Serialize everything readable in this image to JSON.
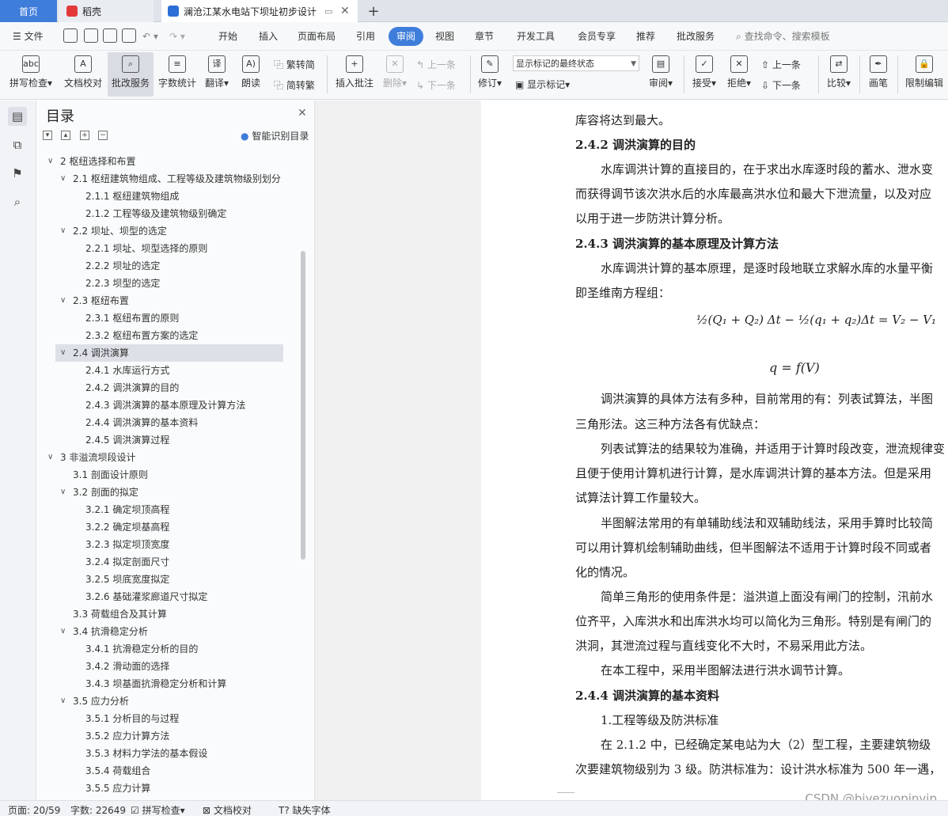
{
  "tabs": {
    "home": "首页",
    "daoke": "稻壳",
    "doc": "澜沧江某水电站下坝址初步设计"
  },
  "menu": {
    "file": "文件",
    "items": [
      "开始",
      "插入",
      "页面布局",
      "引用",
      "审阅",
      "视图",
      "章节",
      "开发工具",
      "会员专享",
      "推荐",
      "批改服务"
    ],
    "active": "审阅",
    "search": "查找命令、搜索模板"
  },
  "ribbon": {
    "spell": "拼写检查",
    "proof": "文档校对",
    "review_service": "批改服务",
    "wordcount": "字数统计",
    "translate": "翻译",
    "read": "朗读",
    "t2s": "繁转简",
    "s2t": "简转繁",
    "insert_comment": "插入批注",
    "delete": "删除",
    "prev_comment": "上一条",
    "next_comment": "下一条",
    "revise": "修订",
    "markup_select": "显示标记的最终状态",
    "show_markup": "显示标记",
    "review": "审阅",
    "accept": "接受",
    "reject": "拒绝",
    "prev": "上一条",
    "next": "下一条",
    "compare": "比较",
    "pen": "画笔",
    "restrict": "限制编辑"
  },
  "toc": {
    "title": "目录",
    "smart": "智能识别目录",
    "items": [
      {
        "t": "2 枢纽选择和布置",
        "l": 0,
        "c": true
      },
      {
        "t": "2.1 枢纽建筑物组成、工程等级及建筑物级别划分",
        "l": 1,
        "c": true
      },
      {
        "t": "2.1.1 枢纽建筑物组成",
        "l": 2
      },
      {
        "t": "2.1.2 工程等级及建筑物级别确定",
        "l": 2
      },
      {
        "t": "2.2 坝址、坝型的选定",
        "l": 1,
        "c": true
      },
      {
        "t": "2.2.1 坝址、坝型选择的原则",
        "l": 2
      },
      {
        "t": "2.2.2 坝址的选定",
        "l": 2
      },
      {
        "t": "2.2.3 坝型的选定",
        "l": 2
      },
      {
        "t": "2.3 枢纽布置",
        "l": 1,
        "c": true
      },
      {
        "t": "2.3.1 枢纽布置的原则",
        "l": 2
      },
      {
        "t": "2.3.2 枢纽布置方案的选定",
        "l": 2
      },
      {
        "t": "2.4 调洪演算",
        "l": 1,
        "c": true,
        "sel": true
      },
      {
        "t": "2.4.1 水库运行方式",
        "l": 2
      },
      {
        "t": "2.4.2 调洪演算的目的",
        "l": 2
      },
      {
        "t": "2.4.3 调洪演算的基本原理及计算方法",
        "l": 2
      },
      {
        "t": "2.4.4 调洪演算的基本资料",
        "l": 2
      },
      {
        "t": "2.4.5 调洪演算过程",
        "l": 2
      },
      {
        "t": "3 非溢流坝段设计",
        "l": 0,
        "c": true
      },
      {
        "t": "3.1 剖面设计原则",
        "l": 1
      },
      {
        "t": "3.2 剖面的拟定",
        "l": 1,
        "c": true
      },
      {
        "t": "3.2.1 确定坝顶高程",
        "l": 2
      },
      {
        "t": "3.2.2 确定坝基高程",
        "l": 2
      },
      {
        "t": "3.2.3 拟定坝顶宽度",
        "l": 2
      },
      {
        "t": "3.2.4 拟定剖面尺寸",
        "l": 2
      },
      {
        "t": "3.2.5 坝底宽度拟定",
        "l": 2
      },
      {
        "t": "3.2.6 基础灌浆廊道尺寸拟定",
        "l": 2
      },
      {
        "t": "3.3 荷载组合及其计算",
        "l": 1
      },
      {
        "t": "3.4 抗滑稳定分析",
        "l": 1,
        "c": true
      },
      {
        "t": "3.4.1 抗滑稳定分析的目的",
        "l": 2
      },
      {
        "t": "3.4.2 滑动面的选择",
        "l": 2
      },
      {
        "t": "3.4.3 坝基面抗滑稳定分析和计算",
        "l": 2
      },
      {
        "t": "3.5 应力分析",
        "l": 1,
        "c": true
      },
      {
        "t": "3.5.1  分析目的与过程",
        "l": 2
      },
      {
        "t": "3.5.2  应力计算方法",
        "l": 2
      },
      {
        "t": "3.5.3  材料力学法的基本假设",
        "l": 2
      },
      {
        "t": "3.5.4 荷载组合",
        "l": 2
      },
      {
        "t": "3.5.5 应力计算",
        "l": 2
      }
    ]
  },
  "doc": {
    "l1": "库容将达到最大。",
    "h1": "2.4.2 调洪演算的目的",
    "l2": "水库调洪计算的直接目的，在于求出水库逐时段的蓄水、泄水变",
    "l3": "而获得调节该次洪水后的水库最高洪水位和最大下泄流量，以及对应",
    "l4": "以用于进一步防洪计算分析。",
    "h2": "2.4.3 调洪演算的基本原理及计算方法",
    "l5": "水库调洪计算的基本原理，是逐时段地联立求解水库的水量平衡",
    "l6": "即圣维南方程组：",
    "f1": "½(Q₁ + Q₂) Δt − ½(q₁ + q₂)Δt = V₂ − V₁",
    "f2": "q = f(V)",
    "l7": "调洪演算的具体方法有多种，目前常用的有：列表试算法，半图",
    "l8": "三角形法。这三种方法各有优缺点：",
    "l9": "列表试算法的结果较为准确，并适用于计算时段改变，泄流规律变",
    "l10": "且便于使用计算机进行计算，是水库调洪计算的基本方法。但是采用",
    "l11": "试算法计算工作量较大。",
    "l12": "半图解法常用的有单辅助线法和双辅助线法，采用手算时比较简",
    "l13": "可以用计算机绘制辅助曲线，但半图解法不适用于计算时段不同或者",
    "l14": "化的情况。",
    "l15": "简单三角形的使用条件是：溢洪道上面没有闸门的控制，汛前水",
    "l16": "位齐平，入库洪水和出库洪水均可以简化为三角形。特别是有闸门的",
    "l17": "洪洞，其泄流过程与直线变化不大时，不易采用此方法。",
    "l18": "在本工程中，采用半图解法进行洪水调节计算。",
    "h3": "2.4.4 调洪演算的基本资料",
    "l19": "1.工程等级及防洪标准",
    "l20": "在 2.1.2 中，已经确定某电站为大（2）型工程，主要建筑物级",
    "l21": "次要建筑物级别为 3 级。防洪标准为：设计洪水标准为 500 年一遇，"
  },
  "status": {
    "page": "页面: 20/59",
    "words": "字数: 22649",
    "spell": "拼写检查",
    "proof": "文档校对",
    "font": "缺失字体"
  },
  "watermark": "CSDN @biyezuopinvip",
  "colors": {
    "accent": "#3f7ddb",
    "daoke": "#e23a3a"
  }
}
